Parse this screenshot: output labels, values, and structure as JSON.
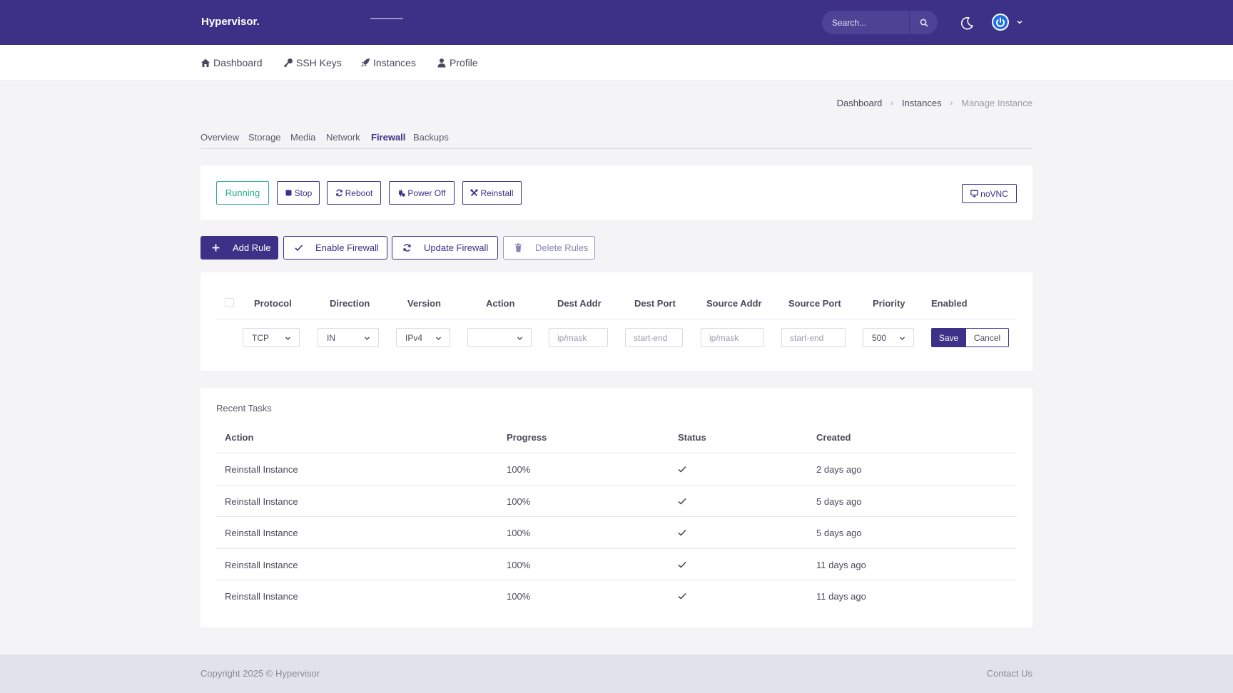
{
  "app": {
    "brand": "Hypervisor."
  },
  "header": {
    "search_placeholder": "Search..."
  },
  "nav": [
    "Dashboard",
    "SSH Keys",
    "Instances",
    "Profile"
  ],
  "breadcrumb": [
    "Dashboard",
    "Instances",
    "Manage Instance"
  ],
  "tabs": [
    "Overview",
    "Storage",
    "Media",
    "Network",
    "Firewall",
    "Backups"
  ],
  "active_tab": "Firewall",
  "controls": {
    "status": "Running",
    "stop": "Stop",
    "reboot": "Reboot",
    "power_off": "Power Off",
    "reinstall": "Reinstall",
    "novnc": "noVNC"
  },
  "firewall_actions": {
    "add_rule": "Add Rule",
    "enable": "Enable Firewall",
    "update": "Update Firewall",
    "delete": "Delete Rules"
  },
  "rules_table": {
    "headers": [
      "Protocol",
      "Direction",
      "Version",
      "Action",
      "Dest Addr",
      "Dest Port",
      "Source Addr",
      "Source Port",
      "Priority",
      "Enabled"
    ],
    "new_rule": {
      "protocol": "TCP",
      "direction": "IN",
      "version": "IPv4",
      "action": "",
      "dest_addr_placeholder": "ip/mask",
      "dest_port_placeholder": "start-end",
      "source_addr_placeholder": "ip/mask",
      "source_port_placeholder": "start-end",
      "priority": "500",
      "save": "Save",
      "cancel": "Cancel"
    }
  },
  "tasks": {
    "title": "Recent Tasks",
    "headers": [
      "Action",
      "Progress",
      "Status",
      "Created"
    ],
    "rows": [
      {
        "action": "Reinstall Instance",
        "progress": "100%",
        "status": "check-icon",
        "created": "2 days ago"
      },
      {
        "action": "Reinstall Instance",
        "progress": "100%",
        "status": "check-icon",
        "created": "5 days ago"
      },
      {
        "action": "Reinstall Instance",
        "progress": "100%",
        "status": "check-icon",
        "created": "5 days ago"
      },
      {
        "action": "Reinstall Instance",
        "progress": "100%",
        "status": "check-icon",
        "created": "11 days ago"
      },
      {
        "action": "Reinstall Instance",
        "progress": "100%",
        "status": "check-icon",
        "created": "11 days ago"
      }
    ]
  },
  "footer": {
    "copyright": "Copyright 2025 © Hypervisor",
    "contact": "Contact Us"
  },
  "colors": {
    "primary": "#3c3186",
    "success": "#2ab08a",
    "background": "#f4f4f7"
  }
}
